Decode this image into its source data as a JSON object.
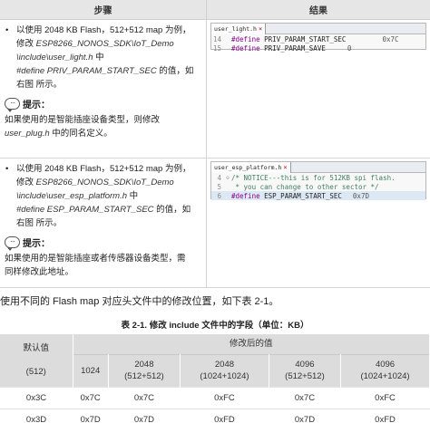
{
  "steps_table": {
    "headers": [
      "步骤",
      "结果"
    ],
    "row1": {
      "bullet": "•",
      "line1": "以使用 2048 KB Flash，512+512 map 为例，",
      "line2_pre": "修改 ",
      "line2_path": "ESP8266_NONOS_SDK\\IoT_Demo",
      "line3_path": "\\include\\user_light.h",
      "line3_post": " 中",
      "line4_define": "#define PRIV_PARAM_START_SEC",
      "line4_post": " 的值，如",
      "line5": "右图 所示。",
      "tip_label": "提示：",
      "tip_line1": "如果使用的是智能插座设备类型，则修改",
      "tip_line2_path": "user_plug.h",
      "tip_line2_post": " 中的同名定义。",
      "code": {
        "tab": "user_light.h",
        "tab_close": "×",
        "lines": [
          {
            "num": "14",
            "kw": "#define",
            "name": " PRIV_PARAM_START_SEC",
            "val": "0x7C"
          },
          {
            "num": "15",
            "kw": "#define",
            "name": " PRIV_PARAM_SAVE",
            "val": "0"
          }
        ]
      }
    },
    "row2": {
      "bullet": "•",
      "line1": "以使用 2048 KB Flash，512+512 map 为例，",
      "line2_pre": "修改 ",
      "line2_path": "ESP8266_NONOS_SDK\\IoT_Demo",
      "line3_path": "\\include\\user_esp_platform.h",
      "line3_post": " 中",
      "line4_define": "#define ESP_PARAM_START_SEC",
      "line4_post": " 的值，如",
      "line5": "右图 所示。",
      "tip_label": "提示：",
      "tip_line1": "如果使用的是智能插座或者传感器设备类型，需",
      "tip_line2": "同样修改此地址。",
      "code": {
        "tab": "user_esp_platform.h",
        "tab_close": "×",
        "lines": [
          {
            "num": "4",
            "text": "/* NOTICE---this is for 512KB spi flash."
          },
          {
            "num": "5",
            "text": " * you can change to other sector */"
          },
          {
            "num": "6",
            "kw": "#define",
            "name": " ESP_PARAM_START_SEC",
            "val": "0x7D"
          }
        ]
      }
    }
  },
  "sentence": "使用不同的 Flash map 对应头文件中的修改位置，如下表 2-1。",
  "caption": "表 2-1. 修改 include 文件中的字段（单位：KB）",
  "table": {
    "corner_line1": "默认值",
    "corner_line2": "(512)",
    "group_header": "修改后的值",
    "columns": [
      {
        "line1": "1024",
        "line2": ""
      },
      {
        "line1": "2048",
        "line2": "(512+512)"
      },
      {
        "line1": "2048",
        "line2": "(1024+1024)"
      },
      {
        "line1": "4096",
        "line2": "(512+512)"
      },
      {
        "line1": "4096",
        "line2": "(1024+1024)"
      }
    ],
    "rows": [
      [
        "0x3C",
        "0x7C",
        "0x7C",
        "0xFC",
        "0x7C",
        "0xFC"
      ],
      [
        "0x3D",
        "0x7D",
        "0x7D",
        "0xFD",
        "0x7D",
        "0xFD"
      ]
    ]
  },
  "icons": {
    "tip": "speech-bubble-icon"
  }
}
